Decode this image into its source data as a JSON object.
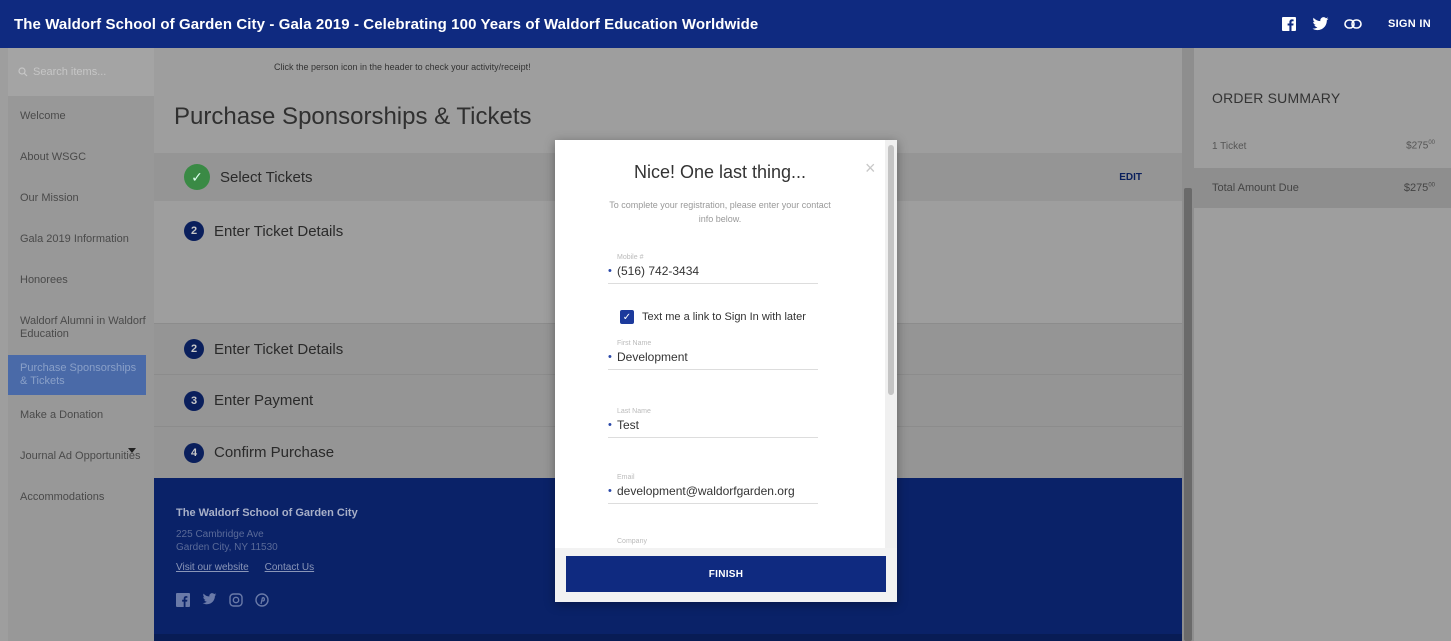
{
  "header": {
    "title": "The Waldorf School of Garden City - Gala 2019 - Celebrating 100 Years of Waldorf Education Worldwide",
    "signin_label": "SIGN IN"
  },
  "sidebar": {
    "search_placeholder": "Search items...",
    "items": [
      {
        "label": "Welcome"
      },
      {
        "label": "About WSGC"
      },
      {
        "label": "Our Mission"
      },
      {
        "label": "Gala 2019 Information"
      },
      {
        "label": "Honorees"
      },
      {
        "label": "Waldorf Alumni in Waldorf Education"
      },
      {
        "label": "Purchase Sponsorships & Tickets"
      },
      {
        "label": "Make a Donation"
      },
      {
        "label": "Journal Ad Opportunities"
      },
      {
        "label": "Accommodations"
      }
    ]
  },
  "main": {
    "notice": "Click the person icon in the header to check your activity/receipt!",
    "page_title": "Purchase Sponsorships & Tickets",
    "steps": [
      {
        "number": "",
        "label": "Select Tickets",
        "completed": true
      },
      {
        "number": "2",
        "label": "Enter Ticket Details"
      },
      {
        "number": "2",
        "label": "Enter Ticket Details"
      },
      {
        "number": "3",
        "label": "Enter Payment"
      },
      {
        "number": "4",
        "label": "Confirm Purchase"
      }
    ],
    "edit_label": "EDIT",
    "footer": {
      "name": "The Waldorf School of Garden City",
      "address_line1": "225 Cambridge Ave",
      "address_line2": "Garden City, NY 11530",
      "link_website": "Visit our website",
      "link_contact": "Contact Us"
    }
  },
  "summary": {
    "title": "ORDER SUMMARY",
    "rows": [
      {
        "label": "1 Ticket",
        "value": "$275",
        "cents": "00"
      },
      {
        "label": "Total Amount Due",
        "value": "$275",
        "cents": "00"
      }
    ]
  },
  "modal": {
    "title": "Nice! One last thing...",
    "subtitle": "To complete your registration, please enter your contact info below.",
    "fields": [
      {
        "label": "Mobile #",
        "value": "(516) 742-3434"
      },
      {
        "label": "First Name",
        "value": "Development"
      },
      {
        "label": "Last Name",
        "value": "Test"
      },
      {
        "label": "Email",
        "value": "development@waldorfgarden.org"
      },
      {
        "label": "Company"
      }
    ],
    "checkbox_label": "Text me a link to Sign In with later",
    "checkbox_checked": true,
    "finish_label": "FINISH",
    "close_glyph": "×"
  },
  "colors": {
    "brand_navy": "#0f2a80",
    "step_number_bg": "#0a1f5c",
    "check_green": "#3a8a45",
    "overlay_gray": "#9e9e9e"
  }
}
